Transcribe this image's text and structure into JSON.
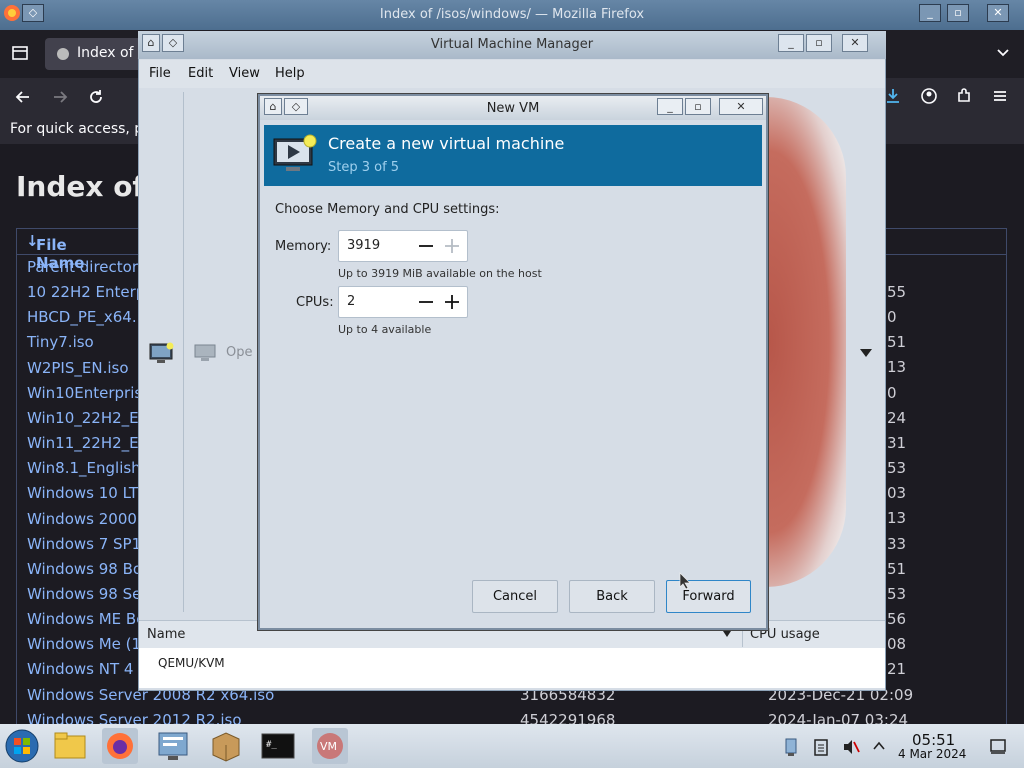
{
  "firefox": {
    "window_title": "Index of /isos/windows/ — Mozilla Firefox",
    "tab_title": "Index of /isos/windows/",
    "bookmarks_text": "For quick access, pl",
    "page_heading": "Index of",
    "table_header": "File Name",
    "files": [
      "Parent directory",
      "10 22H2 Enterp",
      "HBCD_PE_x64.",
      "Tiny7.iso",
      "W2PIS_EN.iso",
      "Win10Enterpris",
      "Win10_22H2_E",
      "Win11_22H2_E",
      "Win8.1_English",
      "Windows 10 LT",
      "Windows 2000",
      "Windows 7 SP1",
      "Windows 98 Bo",
      "Windows 98 Se",
      "Windows ME Bo",
      "Windows Me (1",
      "Windows NT 4",
      "Windows Server 2008 R2 x64.iso",
      "Windows Server 2012 R2.iso"
    ],
    "right_fragments": [
      "55",
      "0",
      "51",
      "13",
      "0",
      "24",
      "31",
      "53",
      "03",
      "13",
      "33",
      "51",
      "53",
      "56",
      "08",
      "21"
    ],
    "last_rows": [
      {
        "size": "3166584832",
        "date": "2023-Dec-21 02:09"
      },
      {
        "size": "4542291968",
        "date": "2024-Jan-07 03:24"
      }
    ]
  },
  "vmm": {
    "window_title": "Virtual Machine Manager",
    "menu": [
      "File",
      "Edit",
      "View",
      "Help"
    ],
    "open_label": "Ope",
    "col_name": "Name",
    "col_cpu": "CPU usage",
    "connection": "QEMU/KVM"
  },
  "dialog": {
    "title": "New VM",
    "heading": "Create a new virtual machine",
    "step": "Step 3 of 5",
    "instructions": "Choose Memory and CPU settings:",
    "memory_label": "Memory:",
    "memory_value": "3919",
    "memory_hint": "Up to 3919 MiB available on the host",
    "cpus_label": "CPUs:",
    "cpus_value": "2",
    "cpus_hint": "Up to 4 available",
    "cancel": "Cancel",
    "back": "Back",
    "forward": "Forward"
  },
  "taskbar": {
    "time": "05:51",
    "date": "4 Mar 2024"
  },
  "colors": {
    "banner": "#0f6b9e",
    "link": "#8ab4f8"
  }
}
